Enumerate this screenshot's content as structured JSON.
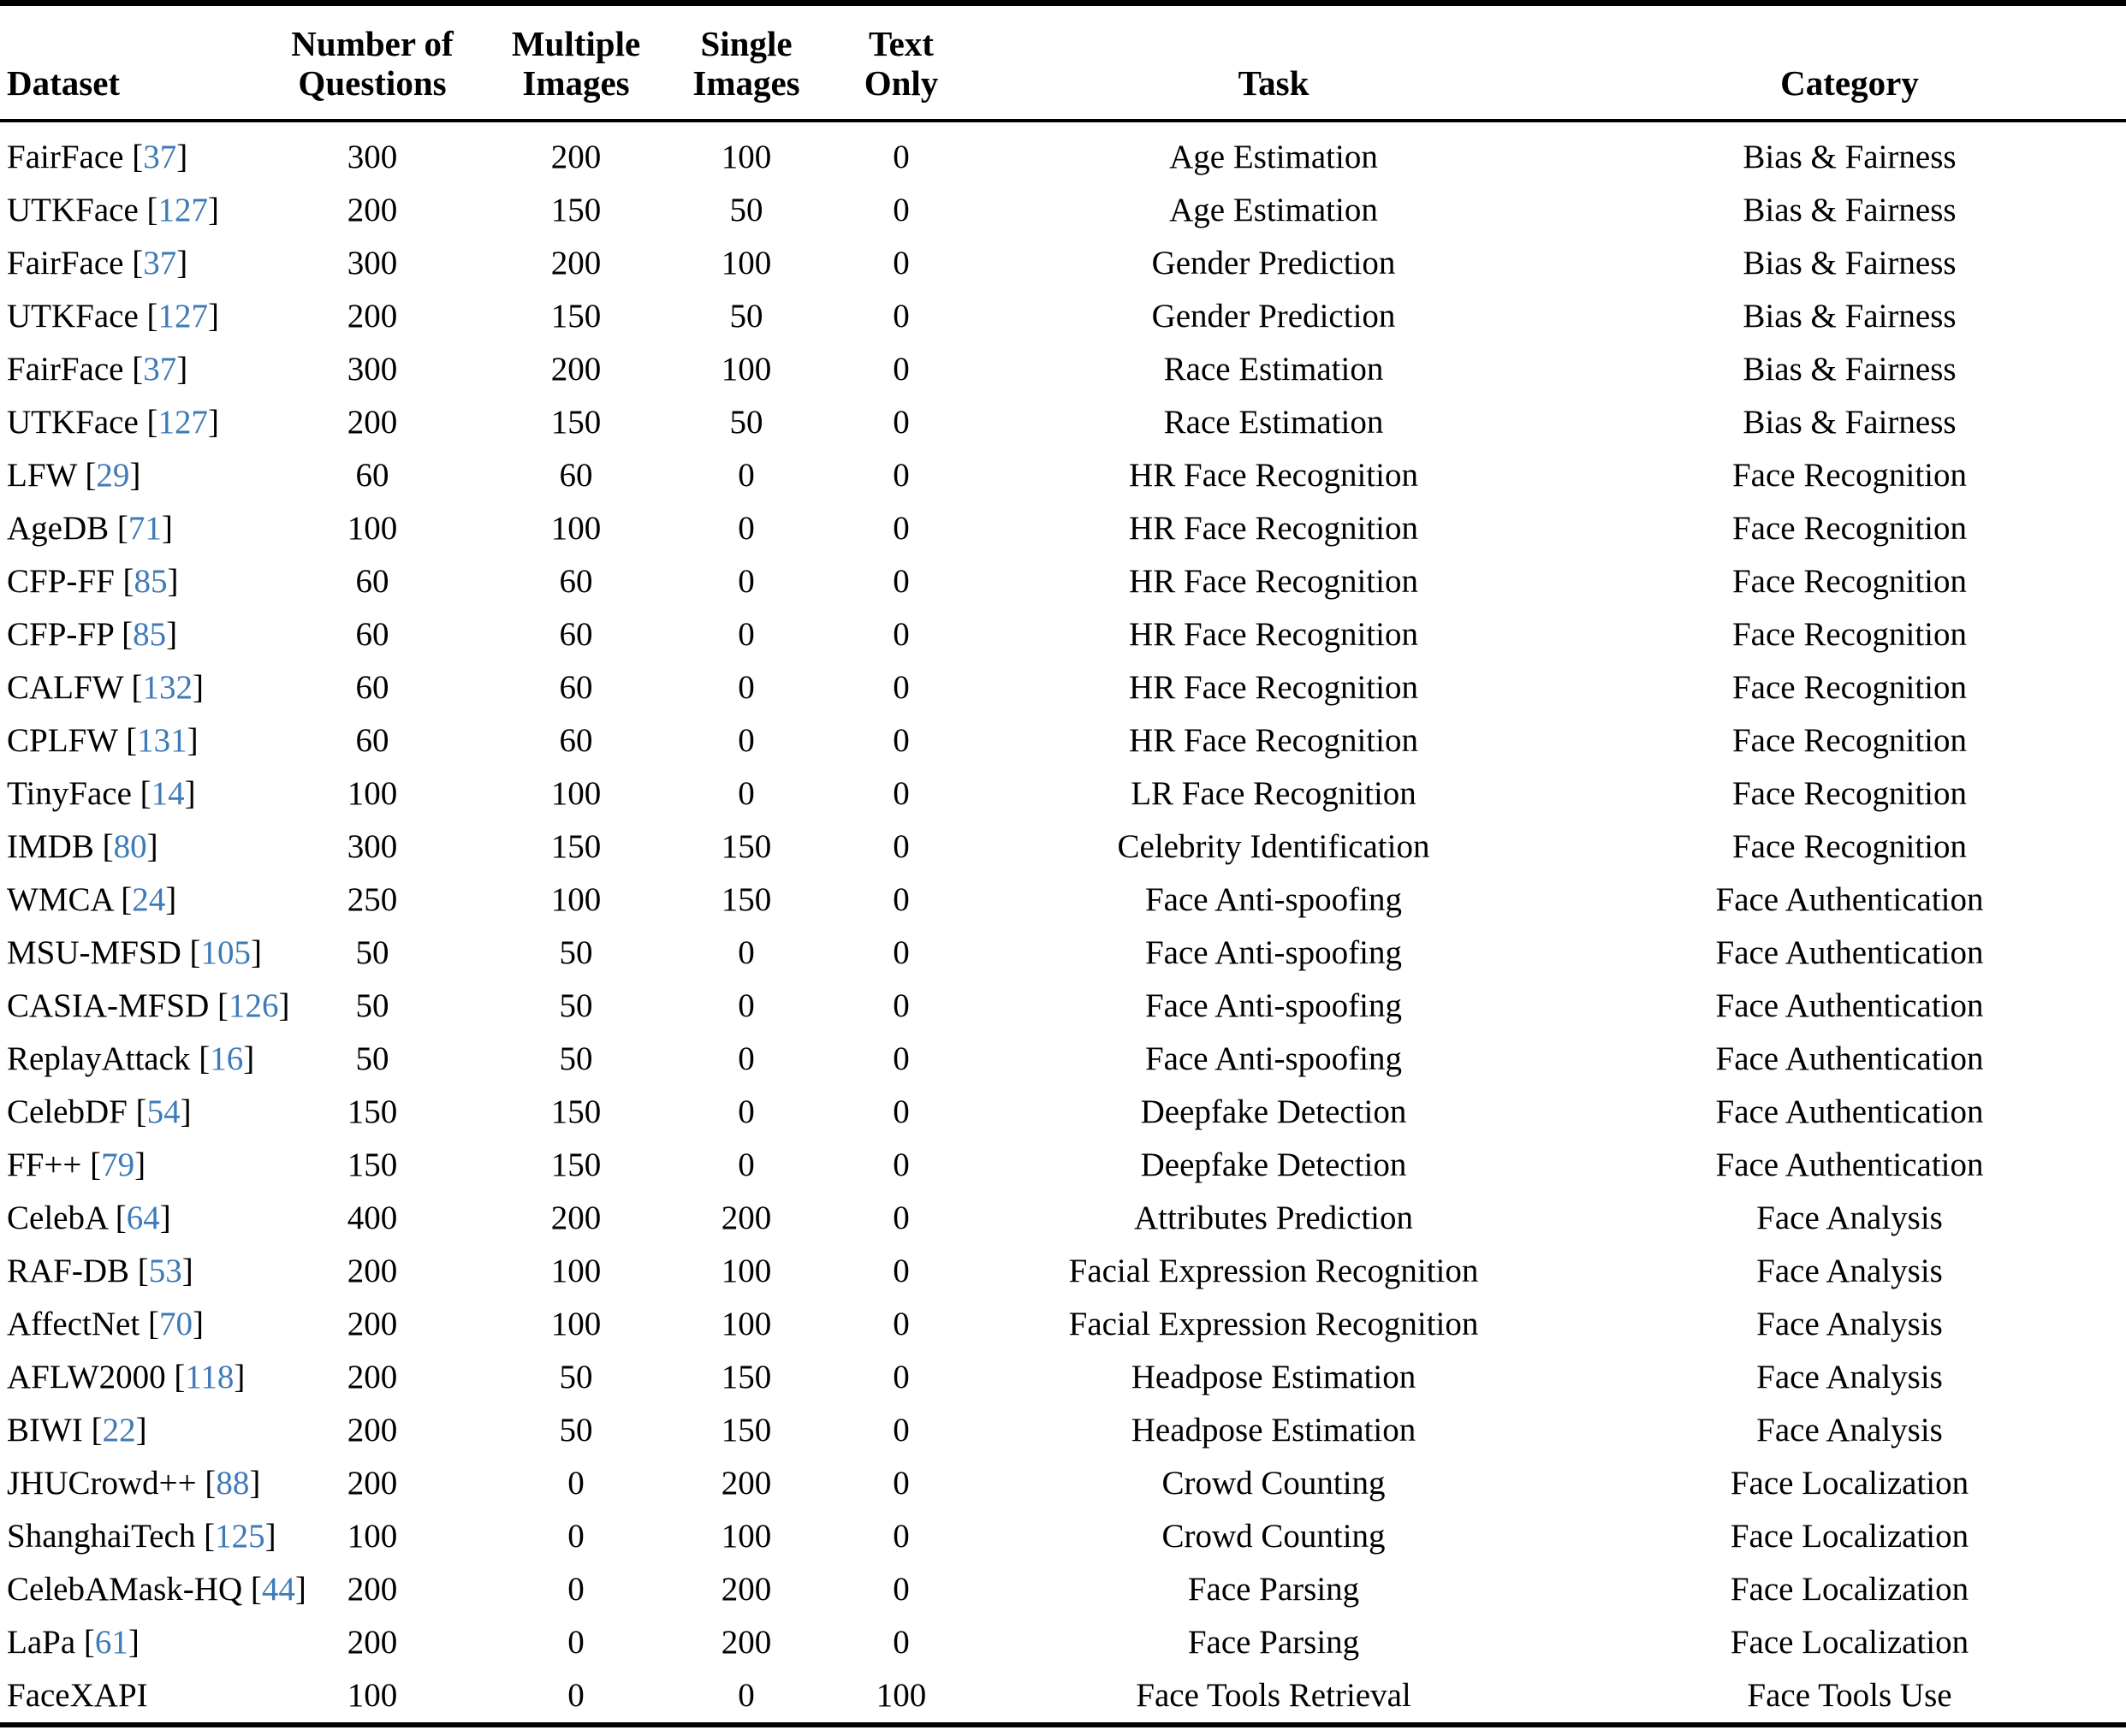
{
  "table": {
    "columns": [
      {
        "key": "dataset",
        "label_line1": "Dataset",
        "label_line2": "",
        "align": "left"
      },
      {
        "key": "num_q",
        "label_line1": "Number of",
        "label_line2": "Questions",
        "align": "center"
      },
      {
        "key": "multi",
        "label_line1": "Multiple",
        "label_line2": "Images",
        "align": "center"
      },
      {
        "key": "single",
        "label_line1": "Single",
        "label_line2": "Images",
        "align": "center"
      },
      {
        "key": "text",
        "label_line1": "Text",
        "label_line2": "Only",
        "align": "center"
      },
      {
        "key": "task",
        "label_line1": "Task",
        "label_line2": "",
        "align": "center"
      },
      {
        "key": "category",
        "label_line1": "Category",
        "label_line2": "",
        "align": "center"
      }
    ],
    "citation_color": "#3d7ab8",
    "rows": [
      {
        "dataset": "FairFace",
        "cite": "37",
        "num_q": "300",
        "multi": "200",
        "single": "100",
        "text": "0",
        "task": "Age Estimation",
        "category": "Bias & Fairness"
      },
      {
        "dataset": "UTKFace",
        "cite": "127",
        "num_q": "200",
        "multi": "150",
        "single": "50",
        "text": "0",
        "task": "Age Estimation",
        "category": "Bias & Fairness"
      },
      {
        "dataset": "FairFace",
        "cite": "37",
        "num_q": "300",
        "multi": "200",
        "single": "100",
        "text": "0",
        "task": "Gender Prediction",
        "category": "Bias & Fairness"
      },
      {
        "dataset": "UTKFace",
        "cite": "127",
        "num_q": "200",
        "multi": "150",
        "single": "50",
        "text": "0",
        "task": "Gender Prediction",
        "category": "Bias & Fairness"
      },
      {
        "dataset": "FairFace",
        "cite": "37",
        "num_q": "300",
        "multi": "200",
        "single": "100",
        "text": "0",
        "task": "Race Estimation",
        "category": "Bias & Fairness"
      },
      {
        "dataset": "UTKFace",
        "cite": "127",
        "num_q": "200",
        "multi": "150",
        "single": "50",
        "text": "0",
        "task": "Race Estimation",
        "category": "Bias & Fairness"
      },
      {
        "dataset": "LFW",
        "cite": "29",
        "num_q": "60",
        "multi": "60",
        "single": "0",
        "text": "0",
        "task": "HR Face Recognition",
        "category": "Face Recognition"
      },
      {
        "dataset": "AgeDB",
        "cite": "71",
        "num_q": "100",
        "multi": "100",
        "single": "0",
        "text": "0",
        "task": "HR Face Recognition",
        "category": "Face Recognition"
      },
      {
        "dataset": "CFP-FF",
        "cite": "85",
        "num_q": "60",
        "multi": "60",
        "single": "0",
        "text": "0",
        "task": "HR Face Recognition",
        "category": "Face Recognition"
      },
      {
        "dataset": "CFP-FP",
        "cite": "85",
        "num_q": "60",
        "multi": "60",
        "single": "0",
        "text": "0",
        "task": "HR Face Recognition",
        "category": "Face Recognition"
      },
      {
        "dataset": "CALFW",
        "cite": "132",
        "num_q": "60",
        "multi": "60",
        "single": "0",
        "text": "0",
        "task": "HR Face Recognition",
        "category": "Face Recognition"
      },
      {
        "dataset": "CPLFW",
        "cite": "131",
        "num_q": "60",
        "multi": "60",
        "single": "0",
        "text": "0",
        "task": "HR Face Recognition",
        "category": "Face Recognition"
      },
      {
        "dataset": "TinyFace",
        "cite": "14",
        "num_q": "100",
        "multi": "100",
        "single": "0",
        "text": "0",
        "task": "LR Face Recognition",
        "category": "Face Recognition"
      },
      {
        "dataset": "IMDB",
        "cite": "80",
        "num_q": "300",
        "multi": "150",
        "single": "150",
        "text": "0",
        "task": "Celebrity Identification",
        "category": "Face Recognition"
      },
      {
        "dataset": "WMCA",
        "cite": "24",
        "num_q": "250",
        "multi": "100",
        "single": "150",
        "text": "0",
        "task": "Face Anti-spoofing",
        "category": "Face Authentication"
      },
      {
        "dataset": "MSU-MFSD",
        "cite": "105",
        "num_q": "50",
        "multi": "50",
        "single": "0",
        "text": "0",
        "task": "Face Anti-spoofing",
        "category": "Face Authentication"
      },
      {
        "dataset": "CASIA-MFSD",
        "cite": "126",
        "num_q": "50",
        "multi": "50",
        "single": "0",
        "text": "0",
        "task": "Face Anti-spoofing",
        "category": "Face Authentication"
      },
      {
        "dataset": "ReplayAttack",
        "cite": "16",
        "num_q": "50",
        "multi": "50",
        "single": "0",
        "text": "0",
        "task": "Face Anti-spoofing",
        "category": "Face Authentication"
      },
      {
        "dataset": "CelebDF",
        "cite": "54",
        "num_q": "150",
        "multi": "150",
        "single": "0",
        "text": "0",
        "task": "Deepfake Detection",
        "category": "Face Authentication"
      },
      {
        "dataset": "FF++",
        "cite": "79",
        "num_q": "150",
        "multi": "150",
        "single": "0",
        "text": "0",
        "task": "Deepfake Detection",
        "category": "Face Authentication"
      },
      {
        "dataset": "CelebA",
        "cite": "64",
        "num_q": "400",
        "multi": "200",
        "single": "200",
        "text": "0",
        "task": "Attributes Prediction",
        "category": "Face Analysis"
      },
      {
        "dataset": "RAF-DB",
        "cite": "53",
        "num_q": "200",
        "multi": "100",
        "single": "100",
        "text": "0",
        "task": "Facial Expression Recognition",
        "category": "Face Analysis"
      },
      {
        "dataset": "AffectNet",
        "cite": "70",
        "num_q": "200",
        "multi": "100",
        "single": "100",
        "text": "0",
        "task": "Facial Expression Recognition",
        "category": "Face Analysis"
      },
      {
        "dataset": "AFLW2000",
        "cite": "118",
        "num_q": "200",
        "multi": "50",
        "single": "150",
        "text": "0",
        "task": "Headpose Estimation",
        "category": "Face Analysis"
      },
      {
        "dataset": "BIWI",
        "cite": "22",
        "num_q": "200",
        "multi": "50",
        "single": "150",
        "text": "0",
        "task": "Headpose Estimation",
        "category": "Face Analysis"
      },
      {
        "dataset": "JHUCrowd++",
        "cite": "88",
        "num_q": "200",
        "multi": "0",
        "single": "200",
        "text": "0",
        "task": "Crowd Counting",
        "category": "Face Localization"
      },
      {
        "dataset": "ShanghaiTech",
        "cite": "125",
        "num_q": "100",
        "multi": "0",
        "single": "100",
        "text": "0",
        "task": "Crowd Counting",
        "category": "Face Localization"
      },
      {
        "dataset": "CelebAMask-HQ",
        "cite": "44",
        "num_q": "200",
        "multi": "0",
        "single": "200",
        "text": "0",
        "task": "Face Parsing",
        "category": "Face Localization"
      },
      {
        "dataset": "LaPa",
        "cite": "61",
        "num_q": "200",
        "multi": "0",
        "single": "200",
        "text": "0",
        "task": "Face Parsing",
        "category": "Face Localization"
      },
      {
        "dataset": "FaceXAPI",
        "cite": "",
        "num_q": "100",
        "multi": "0",
        "single": "0",
        "text": "100",
        "task": "Face Tools Retrieval",
        "category": "Face Tools Use"
      }
    ]
  }
}
